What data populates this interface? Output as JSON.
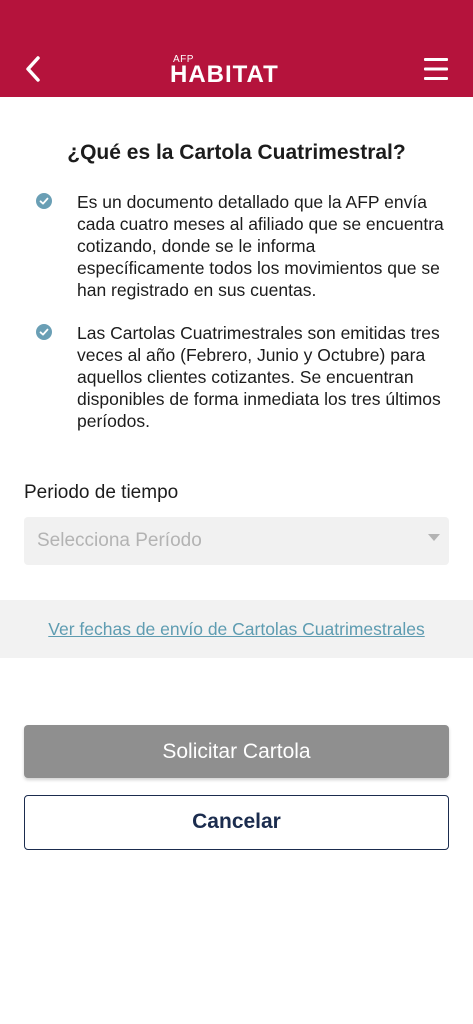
{
  "header": {
    "logo_prefix": "AFP",
    "logo_name": "HABITAT",
    "brand_color": "#b5133c",
    "back_icon": "chevron-left-icon",
    "menu_icon": "hamburger-menu-icon"
  },
  "content": {
    "title": "¿Qué es la Cartola Cuatrimestral?",
    "bullets": [
      "Es un documento detallado que la AFP envía cada cuatro meses al afiliado que se encuentra cotizando, donde se le informa específicamente todos los movimientos que se han registrado en sus cuentas.",
      "Las Cartolas Cuatrimestrales son emitidas tres veces al año (Febrero, Junio y Octubre) para aquellos clientes cotizantes. Se encuentran disponibles de forma inmediata los tres últimos períodos."
    ],
    "bullet_icon": "check-circle-icon",
    "bullet_icon_color": "#6a9fb5"
  },
  "form": {
    "period_label": "Periodo de tiempo",
    "period_placeholder": "Selecciona Período"
  },
  "link": {
    "text": "Ver fechas de envío de Cartolas Cuatrimestrales",
    "color": "#5e9cb1"
  },
  "actions": {
    "submit_label": "Solicitar Cartola",
    "cancel_label": "Cancelar"
  }
}
